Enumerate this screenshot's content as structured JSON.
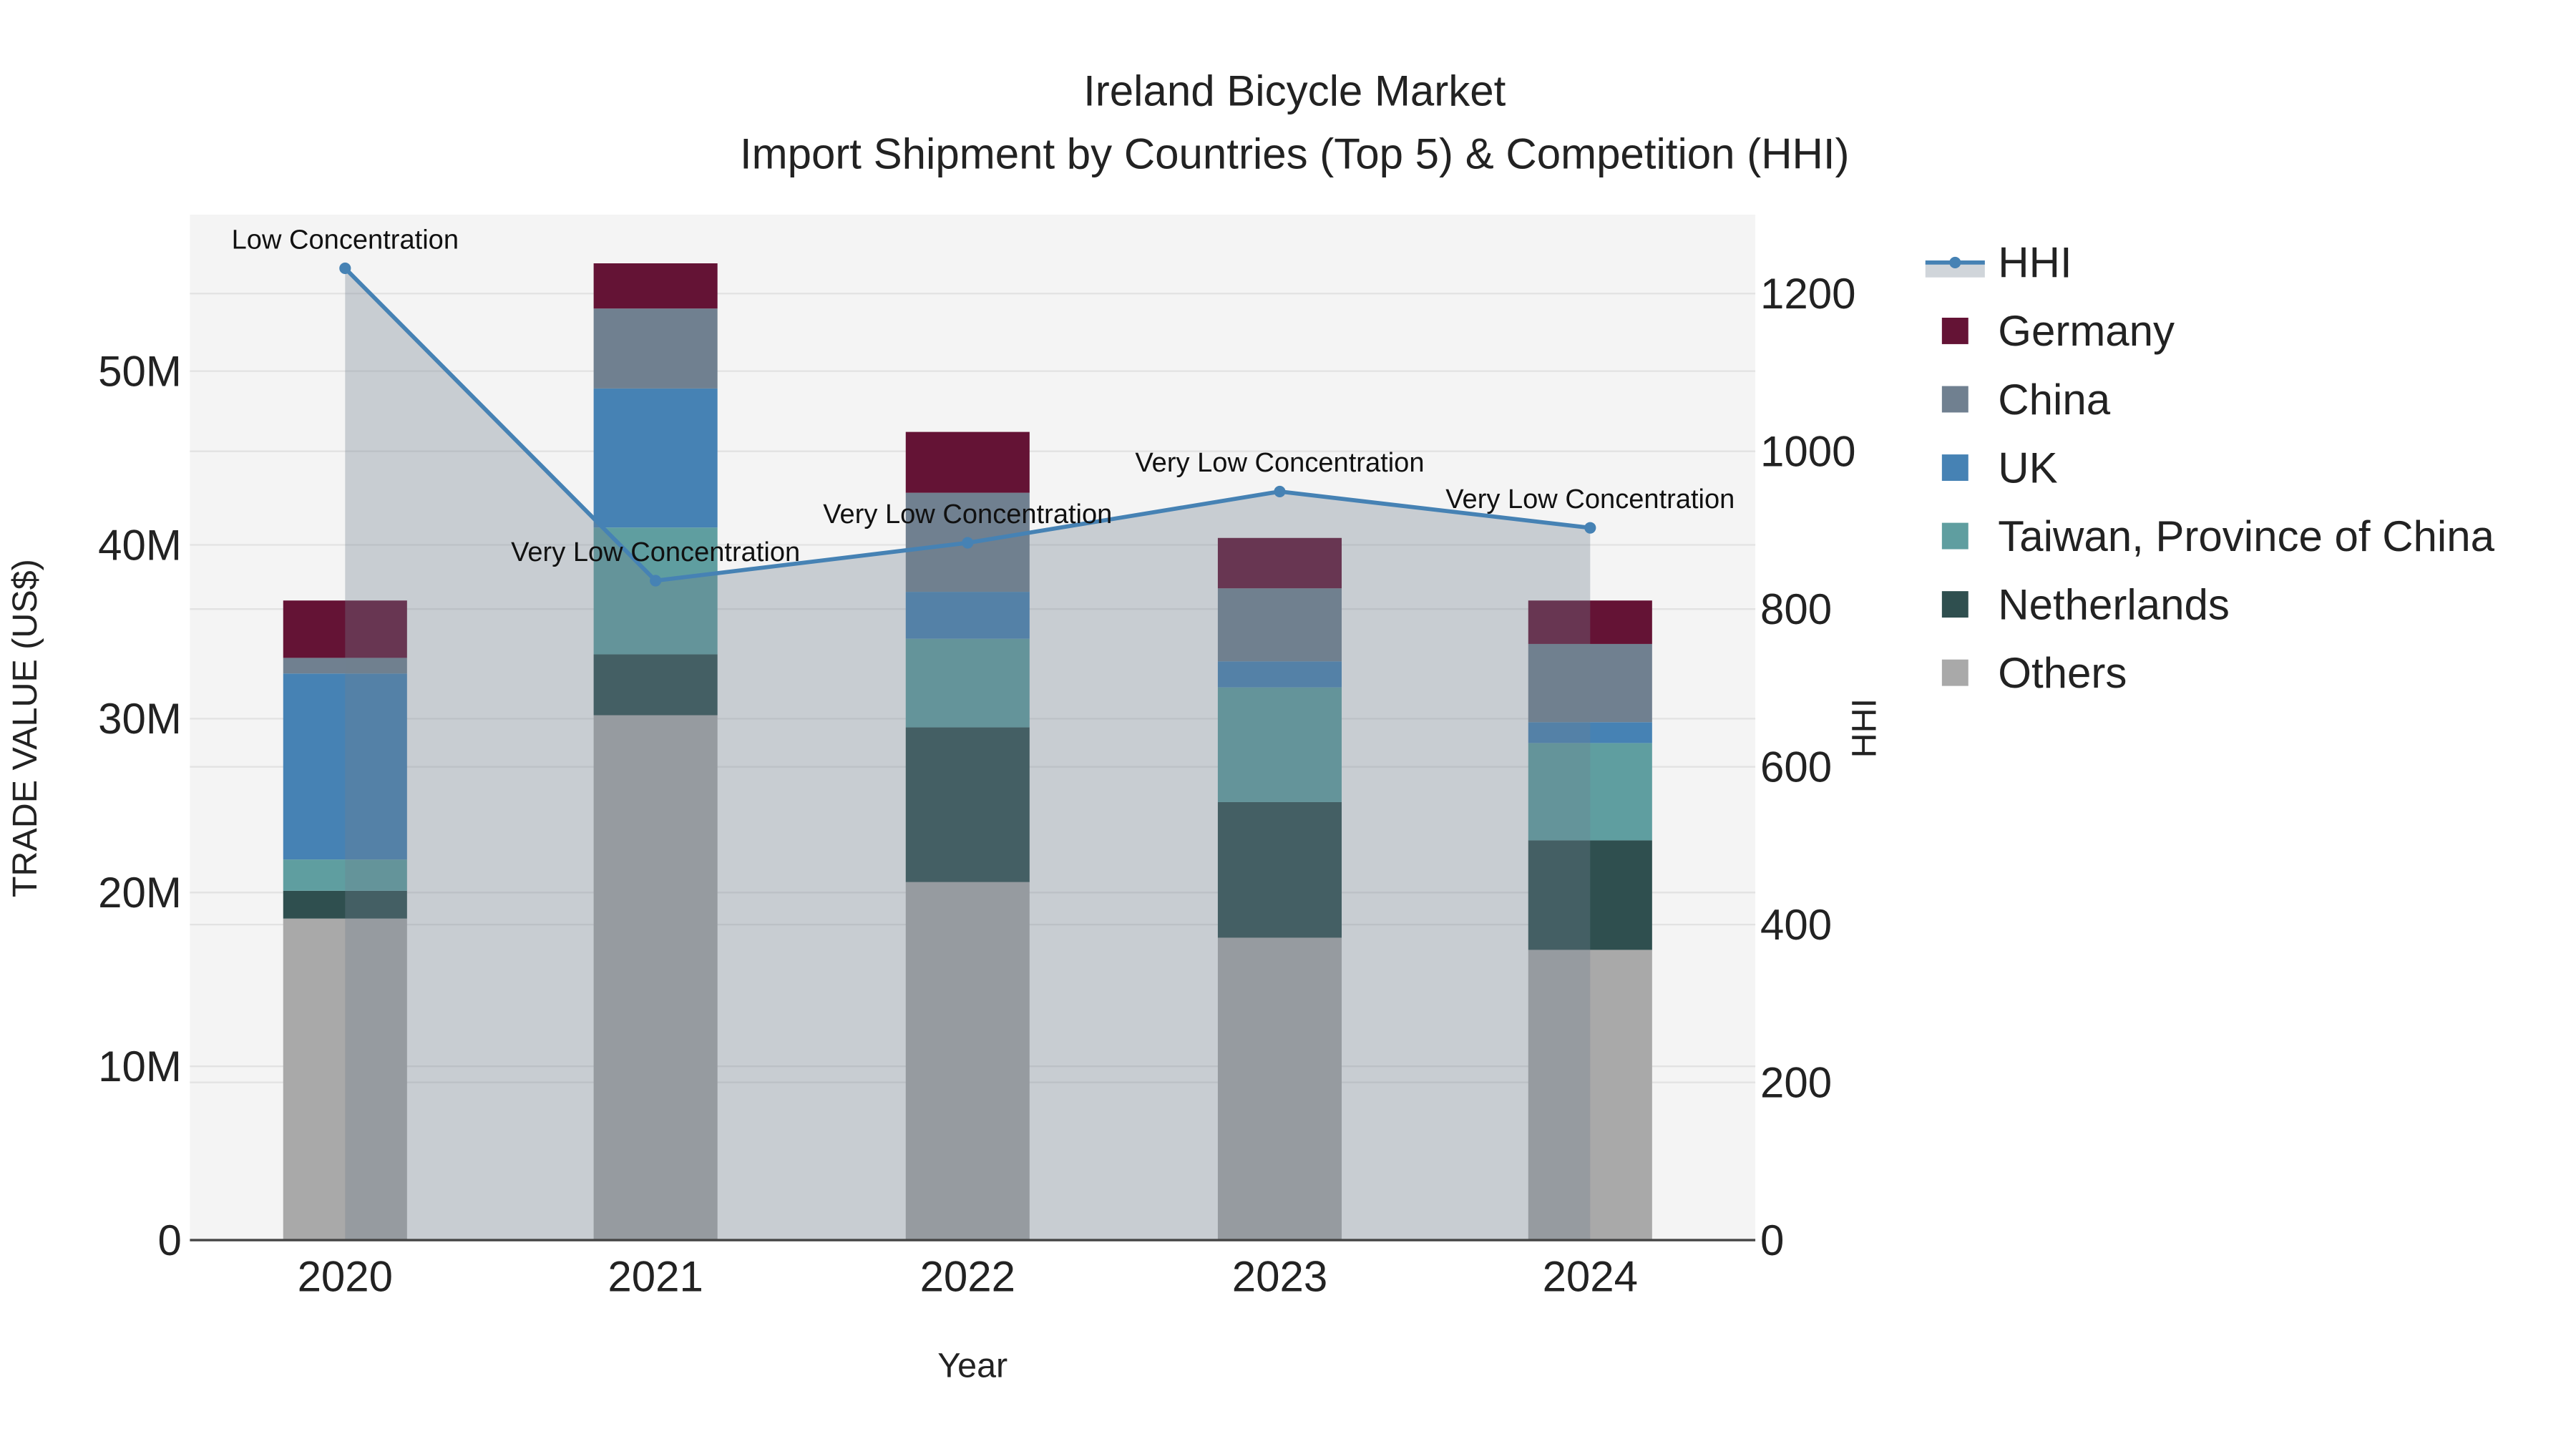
{
  "chart_data": {
    "type": "bar",
    "title": "Ireland Bicycle Market",
    "subtitle": "Import Shipment by Countries (Top 5) & Competition (HHI)",
    "xlabel": "Year",
    "ylabel": "TRADE VALUE (US$)",
    "y2label": "HHI",
    "categories": [
      "2020",
      "2021",
      "2022",
      "2023",
      "2024"
    ],
    "ylim": [
      0,
      59
    ],
    "y2lim": [
      0,
      1300
    ],
    "yticks": [
      {
        "v": 0,
        "label": "0"
      },
      {
        "v": 10,
        "label": "10M"
      },
      {
        "v": 20,
        "label": "20M"
      },
      {
        "v": 30,
        "label": "30M"
      },
      {
        "v": 40,
        "label": "40M"
      },
      {
        "v": 50,
        "label": "50M"
      }
    ],
    "y2ticks": [
      {
        "v": 0,
        "label": "0"
      },
      {
        "v": 200,
        "label": "200"
      },
      {
        "v": 400,
        "label": "400"
      },
      {
        "v": 600,
        "label": "600"
      },
      {
        "v": 800,
        "label": "800"
      },
      {
        "v": 1000,
        "label": "1000"
      },
      {
        "v": 1200,
        "label": "1200"
      }
    ],
    "value_unit": "million US$",
    "stack_order": "bottom-to-top",
    "series": [
      {
        "name": "Others",
        "color": "#A9A9A9",
        "values": [
          18.5,
          30.2,
          20.6,
          17.4,
          16.7
        ]
      },
      {
        "name": "Netherlands",
        "color": "#2F4F4F",
        "values": [
          1.6,
          3.5,
          8.9,
          7.8,
          6.3
        ]
      },
      {
        "name": "Taiwan, Province of China",
        "color": "#5F9EA0",
        "values": [
          1.8,
          7.3,
          5.1,
          6.6,
          5.6
        ]
      },
      {
        "name": "UK",
        "color": "#4682B4",
        "values": [
          10.7,
          8.0,
          2.7,
          1.5,
          1.2
        ]
      },
      {
        "name": "China",
        "color": "#708090",
        "values": [
          0.9,
          4.6,
          5.7,
          4.2,
          4.5
        ]
      },
      {
        "name": "Germany",
        "color": "#641335",
        "values": [
          3.3,
          2.6,
          3.5,
          2.9,
          2.5
        ]
      }
    ],
    "hhi": {
      "name": "HHI",
      "color": "#4682B4",
      "values": [
        1232,
        836,
        884,
        949,
        903
      ],
      "annotations": [
        "Low Concentration",
        "Very Low Concentration",
        "Very Low Concentration",
        "Very Low Concentration",
        "Very Low Concentration"
      ]
    },
    "legend_order": [
      "HHI",
      "Germany",
      "China",
      "UK",
      "Taiwan, Province of China",
      "Netherlands",
      "Others"
    ],
    "legend_position": "right",
    "grid": true
  }
}
